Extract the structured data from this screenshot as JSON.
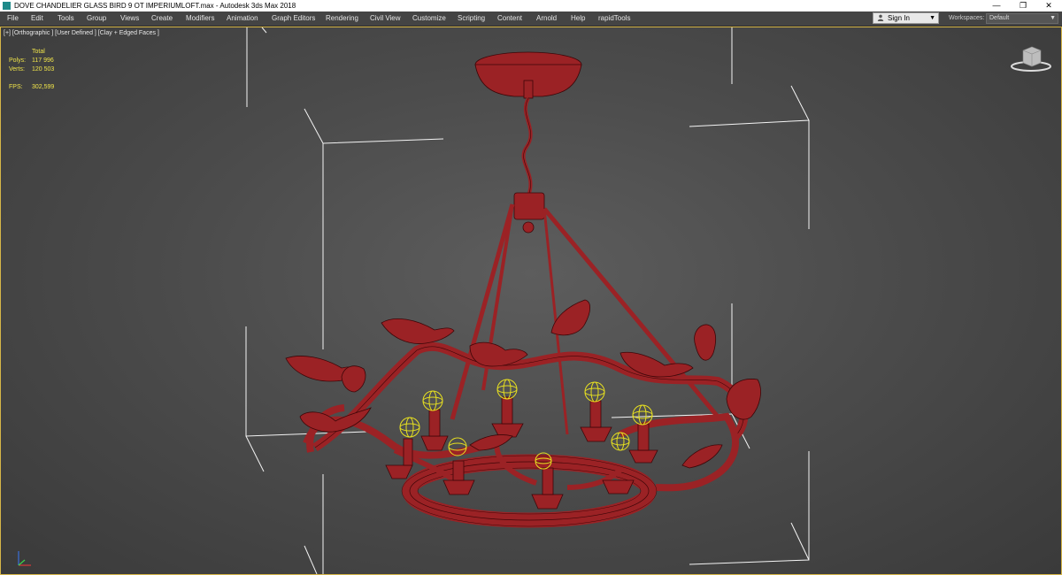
{
  "window": {
    "title": "DOVE CHANDELIER GLASS BIRD 9 OT IMPERIUMLOFT.max - Autodesk 3ds Max 2018",
    "minimize": "—",
    "restore": "❐",
    "close": "✕"
  },
  "menu": [
    "File",
    "Edit",
    "Tools",
    "Group",
    "Views",
    "Create",
    "Modifiers",
    "Animation",
    "Graph Editors",
    "Rendering",
    "Civil View",
    "Customize",
    "Scripting",
    "Content",
    "Arnold",
    "Help",
    "rapidTools"
  ],
  "account": {
    "sign_in": "Sign In",
    "icon": "user-icon"
  },
  "workspaces": {
    "label": "Workspaces:",
    "value": "Default"
  },
  "viewport": {
    "label": "[+] [Orthographic ] [User Defined ] [Clay + Edged Faces ]",
    "stats": {
      "header": "Total",
      "polys_label": "Polys:",
      "polys": "117 996",
      "verts_label": "Verts:",
      "verts": "120 503",
      "fps_label": "FPS:",
      "fps": "302,599"
    }
  },
  "colors": {
    "model": "#a8282a",
    "selection_light": "#e7e020",
    "stats_text": "#f0e44a",
    "viewport_border": "#d6b648"
  }
}
